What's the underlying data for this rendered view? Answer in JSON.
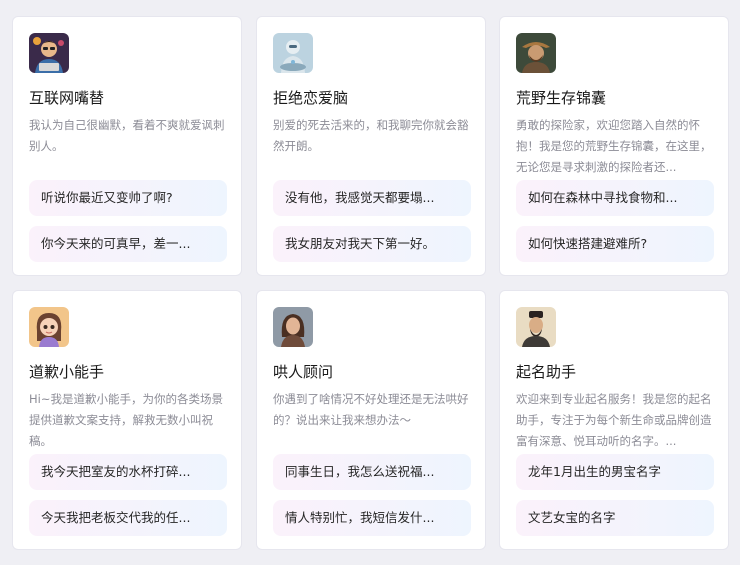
{
  "cards": [
    {
      "title": "互联网嘴替",
      "desc": "我认为自己很幽默，看着不爽就爱讽刺别人。",
      "prompts": [
        "听说你最近又变帅了啊?",
        "你今天来的可真早，差一..."
      ],
      "avatar": "cartoon-man-avatar-icon"
    },
    {
      "title": "拒绝恋爱脑",
      "desc": "别爱的死去活来的，和我聊完你就会豁然开朗。",
      "prompts": [
        "没有他，我感觉天都要塌...",
        "我女朋友对我天下第一好。"
      ],
      "avatar": "robot-avatar-icon"
    },
    {
      "title": "荒野生存锦囊",
      "desc": "勇敢的探险家，欢迎您踏入自然的怀抱！我是您的荒野生存锦囊，在这里，无论您是寻求刺激的探险者还...",
      "prompts": [
        "如何在森林中寻找食物和...",
        "如何快速搭建避难所?"
      ],
      "avatar": "explorer-avatar-icon"
    },
    {
      "title": "道歉小能手",
      "desc": "Hi~我是道歉小能手，为你的各类场景提供道歉文案支持，解救无数小叫祝稿。",
      "prompts": [
        "我今天把室友的水杯打碎...",
        "今天我把老板交代我的任..."
      ],
      "avatar": "cartoon-girl-avatar-icon"
    },
    {
      "title": "哄人顾问",
      "desc": "你遇到了啥情况不好处理还是无法哄好的？说出来让我来想办法～",
      "prompts": [
        "同事生日，我怎么送祝福...",
        "情人特别忙，我短信发什..."
      ],
      "avatar": "woman-avatar-icon"
    },
    {
      "title": "起名助手",
      "desc": "欢迎来到专业起名服务！我是您的起名助手，专注于为每个新生命或品牌创造富有深意、悦耳动听的名字。...",
      "prompts": [
        "龙年1月出生的男宝名字",
        "文艺女宝的名字"
      ],
      "avatar": "scholar-avatar-icon"
    }
  ]
}
